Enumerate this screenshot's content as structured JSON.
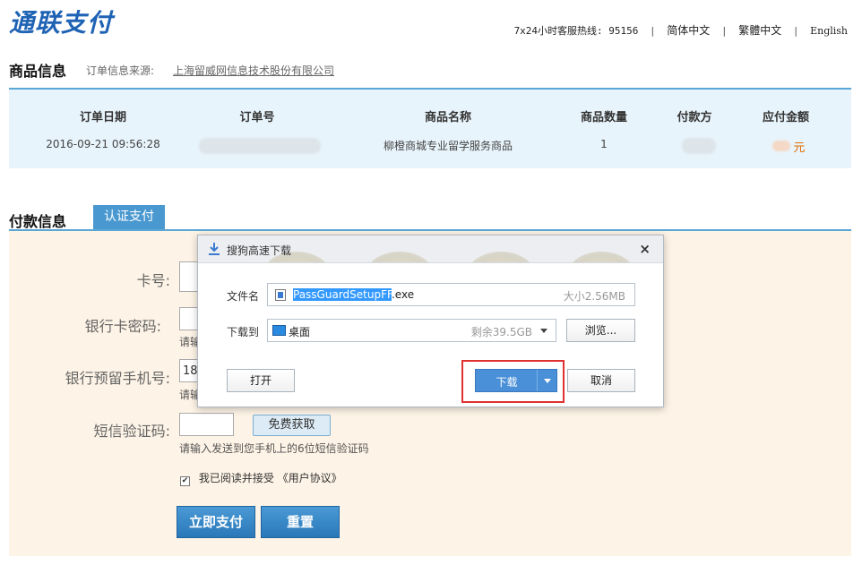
{
  "header": {
    "logo": "通联支付",
    "hotline": "7x24小时客服热线: 95156",
    "lang_simplified": "简体中文",
    "lang_traditional": "繁體中文",
    "lang_english": "English",
    "separator": "|"
  },
  "product": {
    "section_title": "商品信息",
    "source_label": "订单信息来源:",
    "source_value": "上海留威网信息技术股份有限公司",
    "headers": {
      "date": "订单日期",
      "order_no": "订单号",
      "name": "商品名称",
      "qty": "商品数量",
      "payer": "付款方",
      "amount": "应付金额"
    },
    "values": {
      "date": "2016-09-21 09:56:28",
      "name": "柳橙商城专业留学服务商品",
      "qty": "1",
      "amount_unit": "元"
    }
  },
  "payment": {
    "section_title": "付款信息",
    "tab_label": "认证支付",
    "card_label": "卡号:",
    "password_label": "银行卡密码:",
    "password_hint": "请输",
    "phone_label": "银行预留手机号:",
    "phone_value": "18",
    "phone_hint": "请输",
    "sms_label": "短信验证码:",
    "sms_button": "免费获取",
    "sms_hint": "请输入发送到您手机上的6位短信验证码",
    "agree_prefix": "我已阅读并接受",
    "agree_link": "《用户协议》",
    "pay_button": "立即支付",
    "reset_button": "重置"
  },
  "dialog": {
    "title": "搜狗高速下载",
    "close": "×",
    "file_label": "文件名",
    "file_name_selected": "PassGuardSetupFF",
    "file_name_ext": ".exe",
    "file_size": "大小2.56MB",
    "save_label": "下载到",
    "save_location": "桌面",
    "free_space": "剩余39.5GB",
    "browse_button": "浏览...",
    "open_button": "打开",
    "download_button": "下载",
    "cancel_button": "取消"
  },
  "colors": {
    "brand_blue": "#1f63b5",
    "accent_blue": "#4a98d0",
    "highlight_red": "#e03030",
    "amount_orange": "#e06a00"
  }
}
